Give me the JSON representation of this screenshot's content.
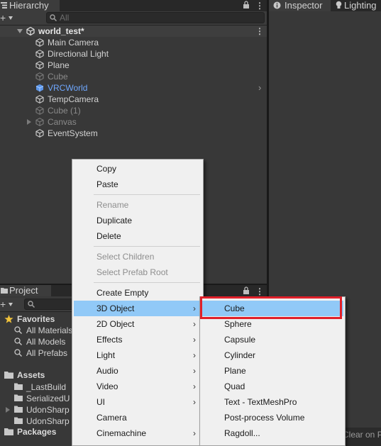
{
  "hierarchy": {
    "tab_label": "Hierarchy",
    "search_placeholder": "All",
    "scene_name": "world_test*",
    "items": [
      {
        "label": "Main Camera",
        "state": "normal"
      },
      {
        "label": "Directional Light",
        "state": "normal"
      },
      {
        "label": "Plane",
        "state": "normal"
      },
      {
        "label": "Cube",
        "state": "inactive"
      },
      {
        "label": "VRCWorld",
        "state": "prefab"
      },
      {
        "label": "TempCamera",
        "state": "normal"
      },
      {
        "label": "Cube (1)",
        "state": "inactive"
      },
      {
        "label": "Canvas",
        "state": "inactive"
      },
      {
        "label": "EventSystem",
        "state": "normal"
      }
    ]
  },
  "inspector": {
    "tabs": [
      {
        "label": "Inspector",
        "icon": "info-icon"
      },
      {
        "label": "Lighting",
        "icon": "lightbulb-icon"
      }
    ]
  },
  "project": {
    "tab_label": "Project",
    "favorites_label": "Favorites",
    "favorites": [
      "All Materials",
      "All Models",
      "All Prefabs"
    ],
    "assets_label": "Assets",
    "assets": [
      "_LastBuild",
      "SerializedU",
      "UdonSharp",
      "UdonSharp"
    ],
    "packages_label": "Packages"
  },
  "status_text": "Clear on P",
  "context_menu": {
    "items": [
      {
        "label": "Copy",
        "enabled": true
      },
      {
        "label": "Paste",
        "enabled": true
      },
      {
        "label": "Rename",
        "enabled": false
      },
      {
        "label": "Duplicate",
        "enabled": true
      },
      {
        "label": "Delete",
        "enabled": true
      },
      {
        "label": "Select Children",
        "enabled": false
      },
      {
        "label": "Select Prefab Root",
        "enabled": false
      },
      {
        "label": "Create Empty",
        "enabled": true
      },
      {
        "label": "3D Object",
        "enabled": true,
        "submenu": true,
        "highlighted": true
      },
      {
        "label": "2D Object",
        "enabled": true,
        "submenu": true
      },
      {
        "label": "Effects",
        "enabled": true,
        "submenu": true
      },
      {
        "label": "Light",
        "enabled": true,
        "submenu": true
      },
      {
        "label": "Audio",
        "enabled": true,
        "submenu": true
      },
      {
        "label": "Video",
        "enabled": true,
        "submenu": true
      },
      {
        "label": "UI",
        "enabled": true,
        "submenu": true
      },
      {
        "label": "Camera",
        "enabled": true
      },
      {
        "label": "Cinemachine",
        "enabled": true,
        "submenu": true
      }
    ],
    "submenu_items": [
      {
        "label": "Cube",
        "highlighted": true
      },
      {
        "label": "Sphere"
      },
      {
        "label": "Capsule"
      },
      {
        "label": "Cylinder"
      },
      {
        "label": "Plane"
      },
      {
        "label": "Quad"
      },
      {
        "label": "Text - TextMeshPro"
      },
      {
        "label": "Post-process Volume"
      },
      {
        "label": "Ragdoll..."
      }
    ]
  },
  "colors": {
    "highlight": "#91c9f7",
    "annotation_box": "#e0202a",
    "prefab_text": "#6fa8ff"
  }
}
